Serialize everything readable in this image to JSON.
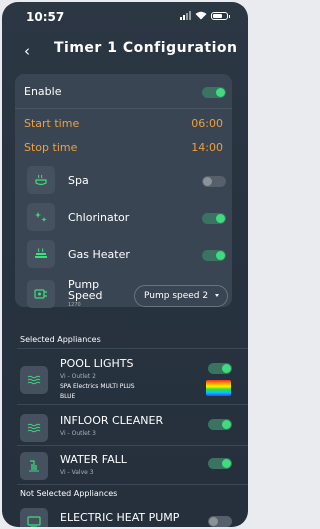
{
  "status_bar": {
    "time": "10:57"
  },
  "header": {
    "title": "Timer 1 Configuration"
  },
  "settings": {
    "enable_label": "Enable",
    "enable_on": true,
    "start_label": "Start time",
    "start_value": "06:00",
    "stop_label": "Stop time",
    "stop_value": "14:00"
  },
  "appliances": [
    {
      "label": "Spa",
      "icon": "spa-icon",
      "on": false
    },
    {
      "label": "Chlorinator",
      "icon": "chlorinator-icon",
      "on": true
    },
    {
      "label": "Gas Heater",
      "icon": "gas-heater-icon",
      "on": true
    }
  ],
  "pump": {
    "label_line1": "Pump",
    "label_line2": "Speed",
    "sub": "1270",
    "selected": "Pump speed 2",
    "icon": "pump-icon"
  },
  "selected_section": {
    "title": "Selected Appliances",
    "items": [
      {
        "name": "POOL LIGHTS",
        "sub": "Vi - Outlet 2",
        "extra1": "SPA Electrics MULTI PLUS",
        "extra2": "BLUE",
        "icon": "waves-icon",
        "on": true
      },
      {
        "name": "INFLOOR CLEANER",
        "sub": "Vi - Outlet 3",
        "icon": "waves-icon",
        "on": true
      },
      {
        "name": "WATER FALL",
        "sub": "Vi - Valve 3",
        "icon": "waterfall-icon",
        "on": true
      }
    ]
  },
  "not_selected_section": {
    "title": "Not Selected Appliances",
    "items": [
      {
        "name": "ELECTRIC HEAT PUMP",
        "icon": "heat-pump-icon",
        "on": false
      }
    ]
  },
  "colors": {
    "accent_green": "#3fdc7d",
    "time_orange": "#f0a03a",
    "background": "#283340"
  }
}
